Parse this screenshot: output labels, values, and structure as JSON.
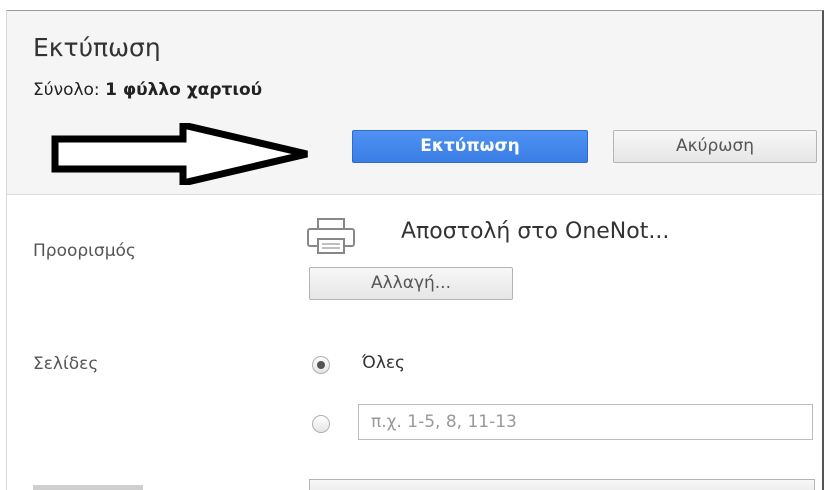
{
  "header": {
    "title": "Εκτύπωση",
    "summary_prefix": "Σύνολο: ",
    "summary_value": "1 φύλλο χαρτιού",
    "print_button": "Εκτύπωση",
    "cancel_button": "Ακύρωση"
  },
  "destination": {
    "label": "Προορισμός",
    "name": "Αποστολή στο OneNot...",
    "change_button": "Αλλαγή..."
  },
  "pages": {
    "label": "Σελίδες",
    "all_option": "Όλες",
    "all_selected": true,
    "custom_placeholder": "π.χ. 1-5, 8, 11-13"
  },
  "icons": {
    "printer": "printer-icon",
    "arrow": "arrow-right-icon"
  },
  "colors": {
    "print_button": "#3f84ec",
    "header_bg": "#f5f5f5"
  }
}
